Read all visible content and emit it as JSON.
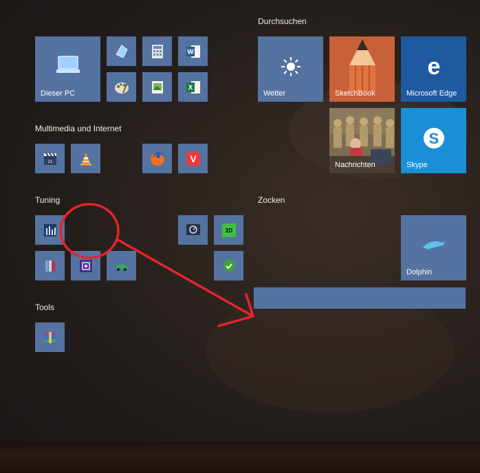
{
  "groups": {
    "multimedia": "Multimedia und Internet",
    "tuning": "Tuning",
    "tools": "Tools",
    "durchsuchen": "Durchsuchen",
    "zocken": "Zocken"
  },
  "tiles": {
    "dieser_pc": "Dieser PC",
    "wetter": "Wetter",
    "sketchbook": "SketchBook",
    "edge": "Microsoft Edge",
    "nachrichten": "Nachrichten",
    "skype": "Skype",
    "dolphin": "Dolphin"
  },
  "icons": {
    "word": "W",
    "excel": "X",
    "edge": "e",
    "skype": "S",
    "vivaldi": "V",
    "twod": "2D"
  },
  "colors": {
    "tile": "#5573a0",
    "annotation": "#e8242a",
    "edge": "#1f5aa0",
    "skype": "#1b8fd6"
  }
}
